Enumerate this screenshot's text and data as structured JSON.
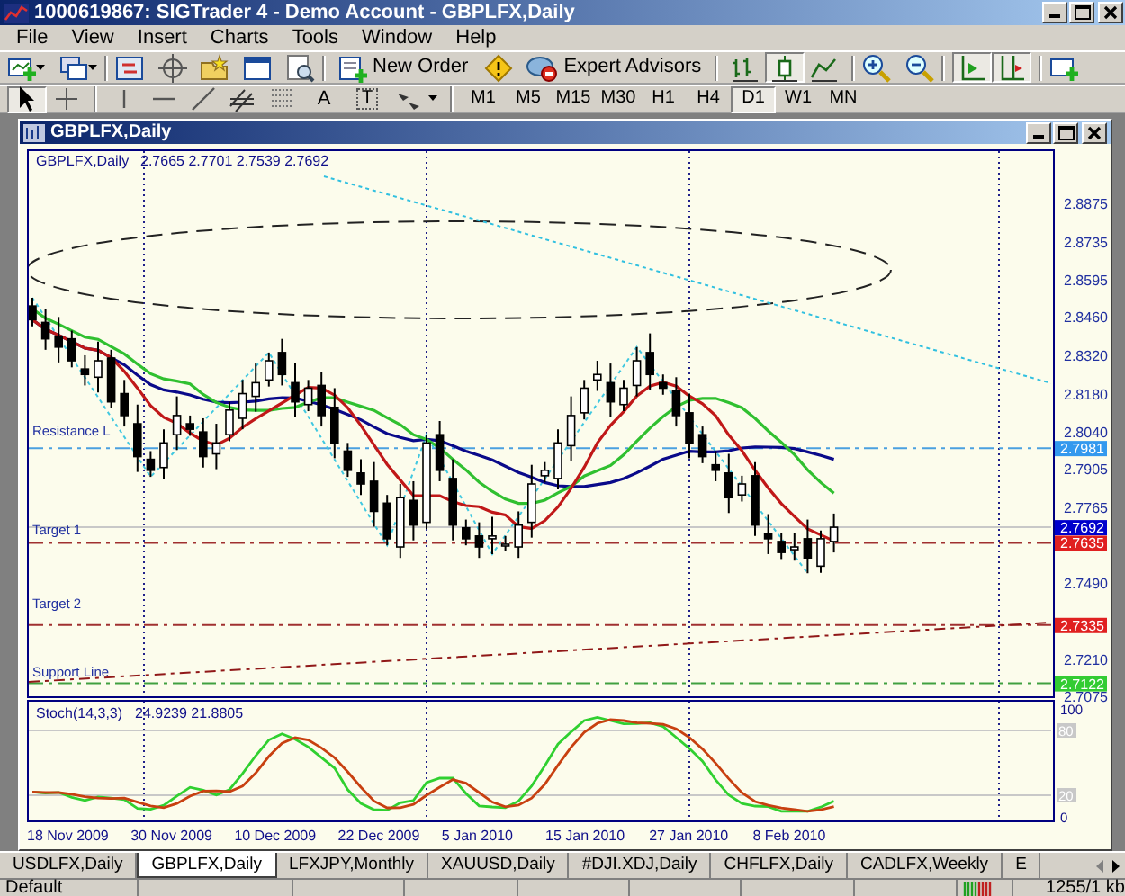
{
  "window": {
    "title": "1000619867: SIGTrader 4 - Demo Account - GBPLFX,Daily"
  },
  "menu": [
    "File",
    "View",
    "Insert",
    "Charts",
    "Tools",
    "Window",
    "Help"
  ],
  "toolbar": {
    "new_order": "New Order",
    "expert_advisors": "Expert Advisors",
    "chart_types": [
      {
        "kind": "bars",
        "selected": false
      },
      {
        "kind": "candles",
        "selected": true
      },
      {
        "kind": "line",
        "selected": false
      }
    ],
    "auto_scroll": true,
    "chart_shift": true
  },
  "tools": [
    {
      "kind": "cursor",
      "selected": true
    },
    {
      "kind": "crosshair",
      "selected": false
    },
    {
      "kind": "vline",
      "selected": false
    },
    {
      "kind": "hline",
      "selected": false
    },
    {
      "kind": "trendline",
      "selected": false
    },
    {
      "kind": "fibo",
      "selected": false
    },
    {
      "kind": "grid",
      "selected": false
    },
    {
      "kind": "text",
      "label": "A",
      "selected": false
    },
    {
      "kind": "textlabel",
      "label": "T",
      "selected": false
    },
    {
      "kind": "arrows",
      "selected": false
    }
  ],
  "timeframes": [
    {
      "label": "M1",
      "selected": false
    },
    {
      "label": "M5",
      "selected": false
    },
    {
      "label": "M15",
      "selected": false
    },
    {
      "label": "M30",
      "selected": false
    },
    {
      "label": "H1",
      "selected": false
    },
    {
      "label": "H4",
      "selected": false
    },
    {
      "label": "D1",
      "selected": true
    },
    {
      "label": "W1",
      "selected": false
    },
    {
      "label": "MN",
      "selected": false
    }
  ],
  "chart_window": {
    "title": "GBPLFX,Daily",
    "symbol": "GBPLFX,Daily",
    "ohlc": "2.7665 2.7701 2.7539 2.7692",
    "price_axis": [
      "2.8875",
      "2.8735",
      "2.8595",
      "2.8460",
      "2.8320",
      "2.8180",
      "2.8040",
      "2.7905",
      "2.7765",
      "2.7490",
      "2.7210",
      "2.7075"
    ],
    "price_tags": [
      {
        "value": "2.7981",
        "color": "#3399ee"
      },
      {
        "value": "2.7692",
        "color": "#0000cc"
      },
      {
        "value": "2.7635",
        "color": "#e02020"
      },
      {
        "value": "2.7335",
        "color": "#e02020"
      },
      {
        "value": "2.7122",
        "color": "#33cc33"
      }
    ],
    "levels": [
      {
        "label": "Resistance L"
      },
      {
        "label": "Target 1"
      },
      {
        "label": "Target 2"
      },
      {
        "label": "Support Line"
      }
    ],
    "indicator": {
      "name": "Stoch(14,3,3)",
      "values": "24.9239 21.8805",
      "axis": [
        {
          "text": "100",
          "kind": "plain"
        },
        {
          "text": "80",
          "kind": "level"
        },
        {
          "text": "20",
          "kind": "level"
        },
        {
          "text": "0",
          "kind": "plain"
        }
      ]
    },
    "dates": [
      "18 Nov 2009",
      "30 Nov 2009",
      "10 Dec 2009",
      "22 Dec 2009",
      "5 Jan 2010",
      "15 Jan 2010",
      "27 Jan 2010",
      "8 Feb 2010"
    ]
  },
  "tabs": [
    {
      "label": "USDLFX,Daily",
      "selected": false
    },
    {
      "label": "GBPLFX,Daily",
      "selected": true
    },
    {
      "label": "LFXJPY,Monthly",
      "selected": false
    },
    {
      "label": "XAUUSD,Daily",
      "selected": false
    },
    {
      "label": "#DJI.XDJ,Daily",
      "selected": false
    },
    {
      "label": "CHFLFX,Daily",
      "selected": false
    },
    {
      "label": "CADLFX,Weekly",
      "selected": false
    },
    {
      "label": "E",
      "selected": false
    }
  ],
  "status_bar": {
    "profile": "Default",
    "traffic": "1255/1 kb"
  }
}
